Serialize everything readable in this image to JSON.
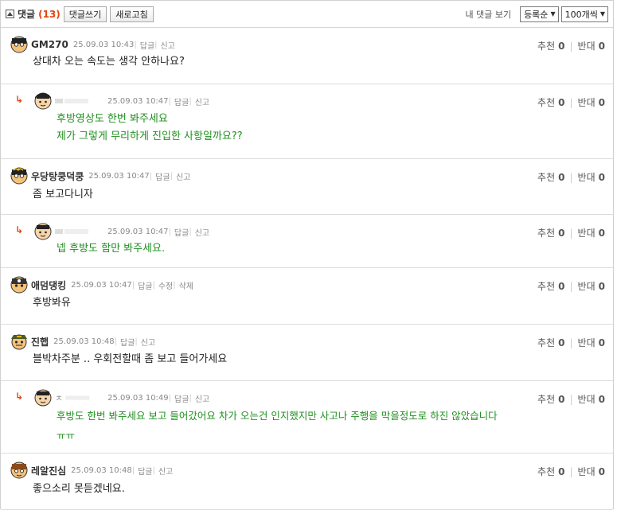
{
  "toolbar": {
    "title": "댓글",
    "count": "(13)",
    "write_button": "댓글쓰기",
    "refresh_button": "새로고침",
    "my_comments": "내 댓글 보기",
    "sort_select": "등록순",
    "page_size_select": "100개씩"
  },
  "labels": {
    "reply": "답글",
    "report": "신고",
    "edit": "수정",
    "delete": "삭제",
    "upvote": "추천",
    "downvote": "반대"
  },
  "comments": [
    {
      "nick": "GM270",
      "time": "25.09.03 10:43",
      "lines": [
        "상대차 오는 속도는 생각 안하나요?"
      ],
      "up": "0",
      "down": "0"
    },
    {
      "nick": "",
      "time": "25.09.03 10:47",
      "lines": [
        "후방영상도 한번 봐주세요",
        "제가 그렇게 무리하게 진입한 사항일까요??"
      ],
      "up": "0",
      "down": "0"
    },
    {
      "nick": "우당탕쿵덕쿵",
      "time": "25.09.03 10:47",
      "lines": [
        "좀 보고다니자"
      ],
      "up": "0",
      "down": "0"
    },
    {
      "nick": "",
      "time": "25.09.03 10:47",
      "lines": [
        "넵 후방도 함만 봐주세요."
      ],
      "up": "0",
      "down": "0"
    },
    {
      "nick": "애덤댕킹",
      "time": "25.09.03 10:47",
      "lines": [
        "후방봐유"
      ],
      "up": "0",
      "down": "0"
    },
    {
      "nick": "진햅",
      "time": "25.09.03 10:48",
      "lines": [
        "블박차주분 .. 우회전할때 좀 보고 들어가세요"
      ],
      "up": "0",
      "down": "0"
    },
    {
      "nick": "ㅊ",
      "time": "25.09.03 10:49",
      "lines": [
        "후방도 한번 봐주세요 보고 들어갔어요 차가 오는건 인지했지만 사고나 주행을 막을정도로 하진 않았습니다",
        "ㅠㅠ"
      ],
      "up": "0",
      "down": "0"
    },
    {
      "nick": "레알진심",
      "time": "25.09.03 10:48",
      "lines": [
        "좋으소리 못듣겠네요."
      ],
      "up": "0",
      "down": "0"
    }
  ],
  "colors": {
    "count": "#e2440f",
    "reply_text": "#1f8f1f"
  }
}
